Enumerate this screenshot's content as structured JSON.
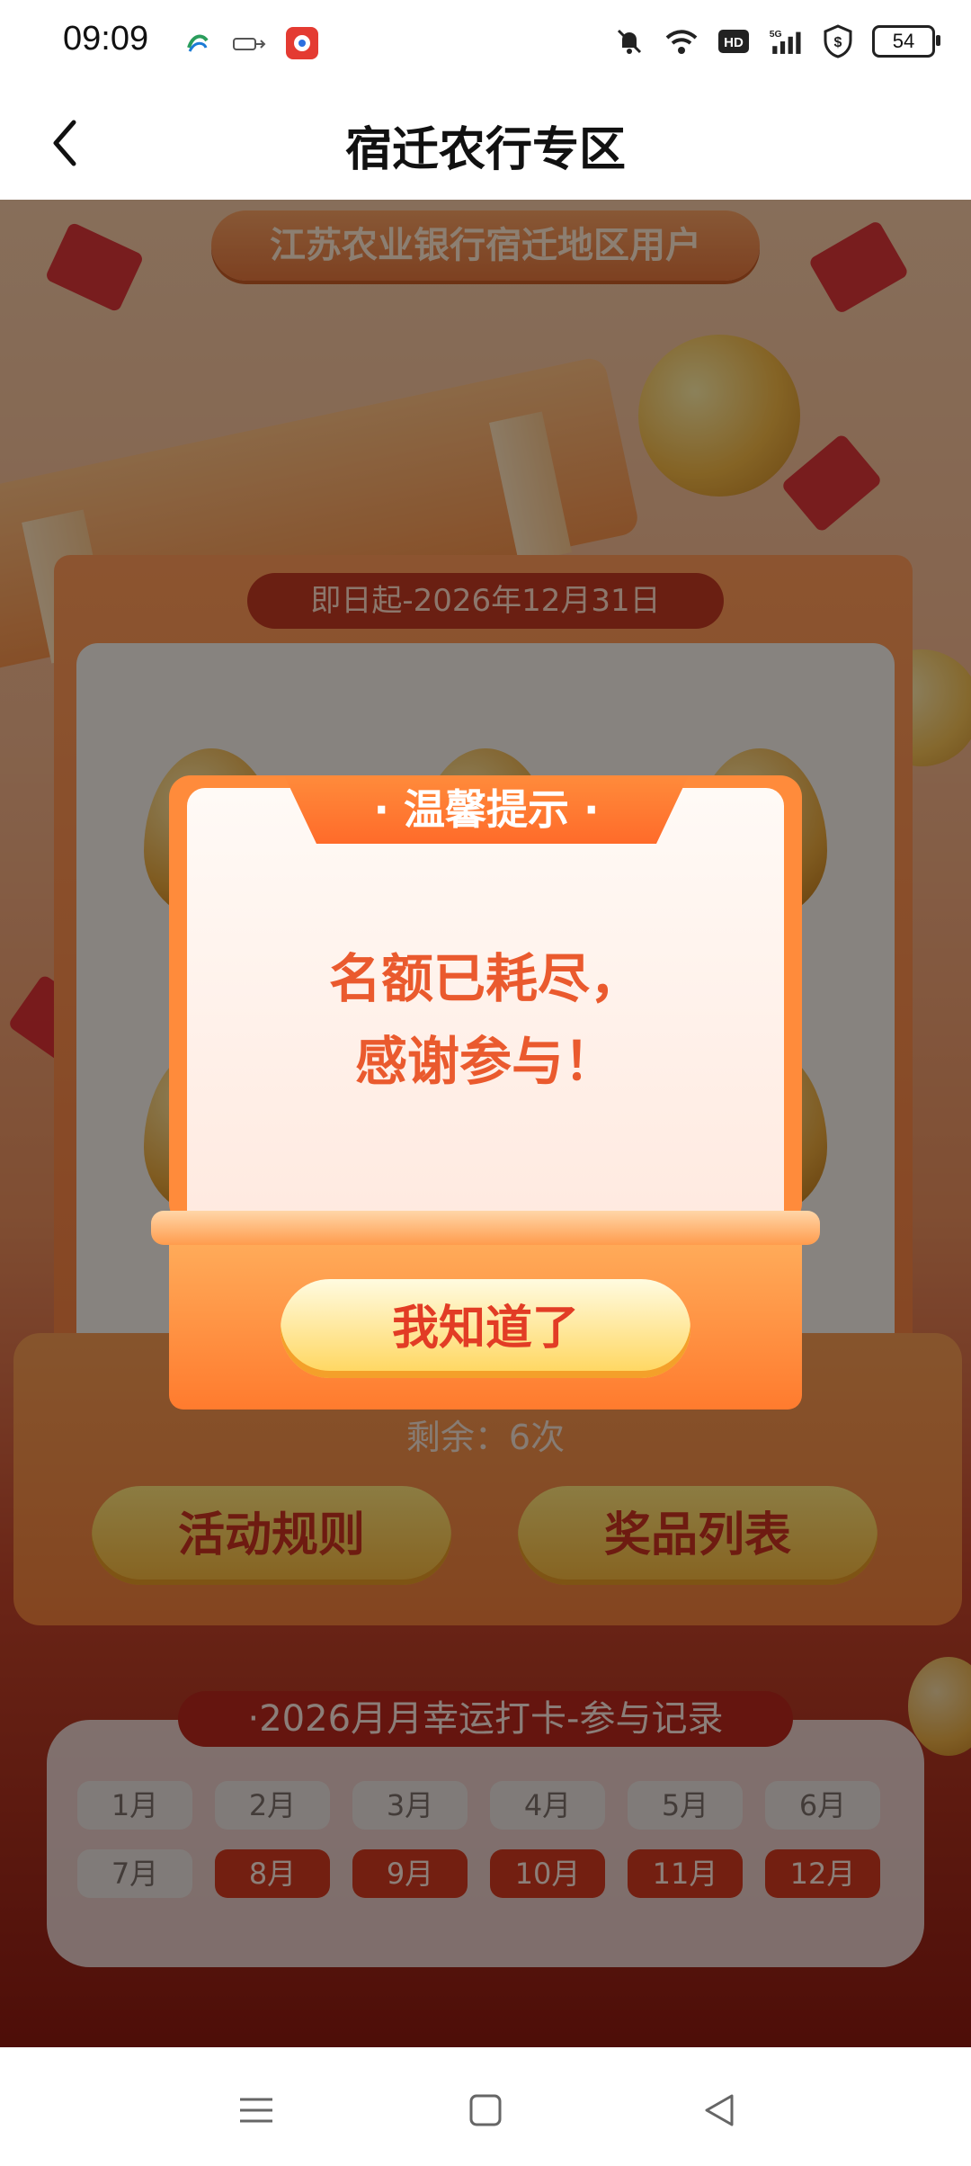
{
  "status_bar": {
    "time": "09:09",
    "network": "5G",
    "hd": "HD",
    "battery": "54",
    "icons": [
      "china-mobile-icon",
      "data-transfer-icon",
      "app-notification-icon",
      "mute-bell-icon",
      "wifi-icon",
      "hd-icon",
      "signal-icon",
      "shield-dollar-icon",
      "battery-icon"
    ]
  },
  "header": {
    "title": "宿迁农行专区",
    "back_icon": "chevron-left-icon"
  },
  "banner": {
    "region_label": "江苏农业银行宿迁地区用户",
    "date_range": "即日起-2026年12月31日",
    "remaining": "剩余：6次",
    "buttons": {
      "rules": "活动规则",
      "prizes": "奖品列表"
    }
  },
  "records": {
    "title": "·2026月月幸运打卡-参与记录",
    "months": [
      {
        "label": "1月",
        "state": "unsigned"
      },
      {
        "label": "2月",
        "state": "unsigned"
      },
      {
        "label": "3月",
        "state": "unsigned"
      },
      {
        "label": "4月",
        "state": "unsigned"
      },
      {
        "label": "5月",
        "state": "unsigned"
      },
      {
        "label": "6月",
        "state": "unsigned"
      },
      {
        "label": "7月",
        "state": "unsigned"
      },
      {
        "label": "8月",
        "state": "active"
      },
      {
        "label": "9月",
        "state": "active"
      },
      {
        "label": "10月",
        "state": "active"
      },
      {
        "label": "11月",
        "state": "active"
      },
      {
        "label": "12月",
        "state": "active"
      }
    ]
  },
  "dialog": {
    "title": "· 温馨提示 ·",
    "message_line1": "名额已耗尽，",
    "message_line2": "感谢参与！",
    "ok_button": "我知道了"
  },
  "nav": {
    "icons": [
      "menu-icon",
      "home-icon",
      "back-triangle-icon"
    ]
  },
  "colors": {
    "accent_orange": "#ff7b2e",
    "dialog_text": "#ea5a2e",
    "active_month": "#d13a1f"
  }
}
